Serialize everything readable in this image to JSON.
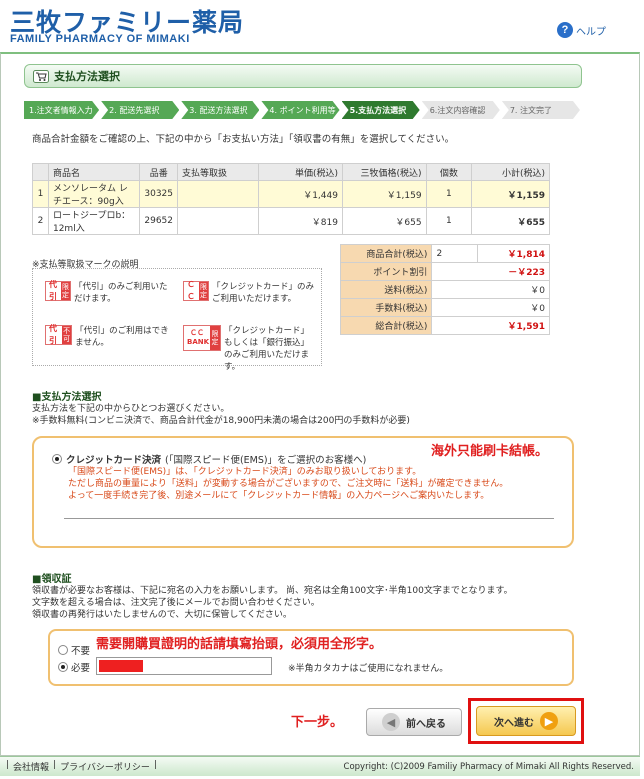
{
  "header": {
    "logo_jp": "三牧ファミリー薬局",
    "logo_en": "FAMILY PHARMACY OF MIMAKI",
    "help_label": "ヘルプ"
  },
  "section_title": "支払方法選択",
  "steps": [
    {
      "label": "1.注文者情報入力",
      "state": "done"
    },
    {
      "label": "2. 配送先選択",
      "state": "done"
    },
    {
      "label": "3. 配送方法選択",
      "state": "done"
    },
    {
      "label": "4. ポイント利用等",
      "state": "done"
    },
    {
      "label": "5.支払方法選択",
      "state": "active"
    },
    {
      "label": "6.注文内容確認",
      "state": "future"
    },
    {
      "label": "7. 注文完了",
      "state": "future"
    }
  ],
  "intro": "商品合計金額をご確認の上、下記の中から「お支払い方法」「領収書の有無」を選択してください。",
  "table": {
    "headers": [
      "商品名",
      "品番",
      "支払等取扱",
      "単価(税込)",
      "三牧価格(税込)",
      "個数",
      "小計(税込)"
    ],
    "rows": [
      {
        "no": "1",
        "name": "メンソレータム レチエース：90g入",
        "code": "30325",
        "mark": "",
        "unit": "￥1,449",
        "price": "￥1,159",
        "qty": "1",
        "subtotal": "￥1,159"
      },
      {
        "no": "2",
        "name": "ロートジープロb：12ml入",
        "code": "29652",
        "mark": "",
        "unit": "￥819",
        "price": "￥655",
        "qty": "1",
        "subtotal": "￥655"
      }
    ]
  },
  "totals": {
    "goods_label": "商品合計(税込)",
    "goods_qty": "2",
    "goods_value": "￥1,814",
    "point_label": "ポイント割引",
    "point_value": "－￥223",
    "shipping_label": "送料(税込)",
    "shipping_value": "￥0",
    "fee_label": "手数料(税込)",
    "fee_value": "￥0",
    "total_label": "総合計(税込)",
    "total_value": "￥1,591"
  },
  "legend": {
    "title": "※支払等取扱マークの説明",
    "m1_a": "代引",
    "m1_b": "限定",
    "m1_text": "「代引」のみご利用いただけます。",
    "m2_a": "ＣＣ",
    "m2_b": "限定",
    "m2_text": "「クレジットカード」のみご利用いただけます。",
    "m3_a": "代引",
    "m3_b": "不可",
    "m3_text": "「代引」のご利用はできません。",
    "m4_a": "ＣＣ BANK",
    "m4_b": "限定",
    "m4_text": "「クレジットカード」もしくは「銀行振込」のみご利用いただけます。"
  },
  "payment": {
    "heading": "■支払方法選択",
    "line1": "支払方法を下記の中からひとつお選びください。",
    "line2": "※手数料無料(コンビニ決済で、商品合計代金が18,900円未満の場合は200円の手数料が必要)",
    "option_bold": "クレジットカード決済",
    "option_rest": "(「国際スピード便(EMS)」をご選択のお客様へ)",
    "note1": "「国際スピード便(EMS)」は、「クレジットカード決済」のみお取り扱いしております。",
    "note2": "ただし商品の重量により「送料」が変動する場合がございますので、ご注文時に「送料」が確定できません。",
    "note3": "よって一度手続き完了後、別途メールにて「クレジットカード情報」の入力ページへご案内いたします。",
    "annotation": "海外只能刷卡結帳。"
  },
  "receipt": {
    "heading": "■領収証",
    "line1": "領収書が必要なお客様は、下記に宛名の入力をお願いします。 尚、宛名は全角100文字･半角100文字までとなります。",
    "line2": "文字数を超える場合は、注文完了後にメールでお問い合わせください。",
    "line3": "領収書の再発行はいたしませんので、大切に保管してください。",
    "opt_no": "不要",
    "opt_yes": "必要",
    "annotation": "需要開購買證明的話請填寫抬頭，必須用全形字。",
    "note": "※半角カタカナはご使用になれません。"
  },
  "nav": {
    "next_annotation": "下一步。",
    "back_label": "前へ戻る",
    "next_label": "次へ進む"
  },
  "footer": {
    "link1": "会社情報",
    "link2": "プライバシーポリシー",
    "copyright": "Copyright: (C)2009 Familiy Pharmacy of Mimaki All Rights Reserved."
  },
  "colors": {
    "brand": "#1f5fa8",
    "step_done": "#55a855",
    "step_active": "#2f7a2f",
    "accent_red": "#d01010"
  }
}
